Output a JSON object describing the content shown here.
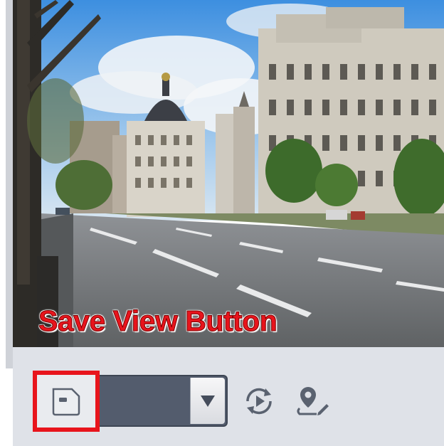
{
  "caption": {
    "text": "Save View Button"
  },
  "toolbar": {
    "save_view_icon": "save-view-icon",
    "preset_select": {
      "value": "",
      "arrow_icon": "chevron-down-icon"
    },
    "cycle_icon": "preset-cycle-icon",
    "locate_icon": "location-edit-icon"
  },
  "colors": {
    "highlight": "#e8141c",
    "toolbar_bg": "#dfe2e8",
    "select_bg": "#535c6d",
    "icon": "#5a6270"
  }
}
